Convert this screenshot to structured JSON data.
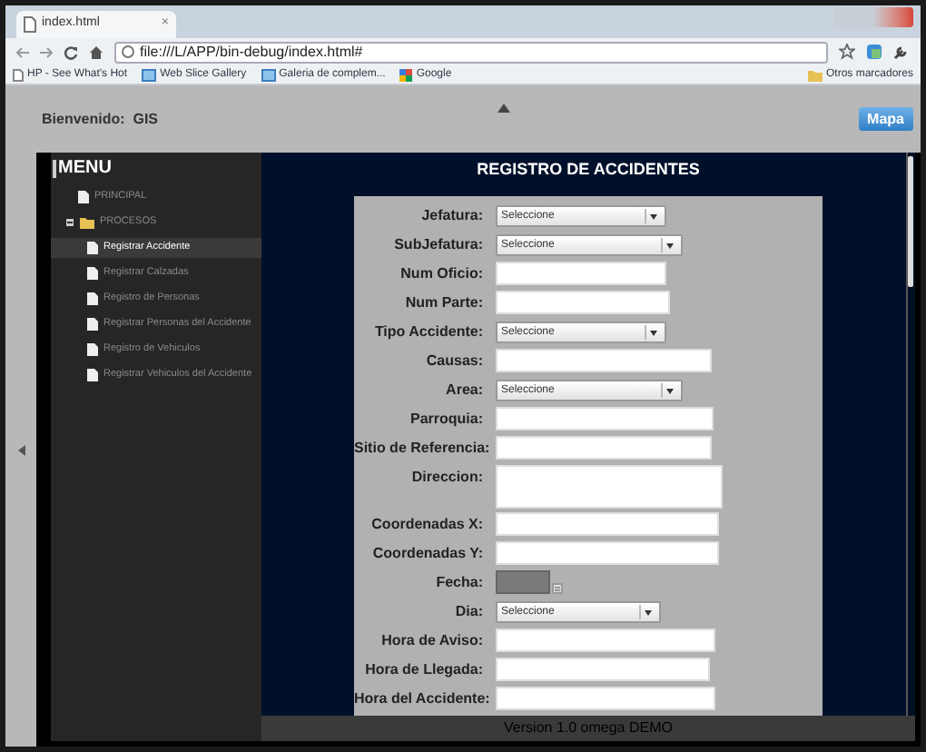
{
  "browser": {
    "tab": {
      "title": "index.html",
      "close": "×"
    },
    "address": "file:///L/APP/bin-debug/index.html#",
    "bookmarks": [
      {
        "label": "HP - See What's Hot",
        "kind": "page"
      },
      {
        "label": "Web Slice Gallery",
        "kind": "slice"
      },
      {
        "label": "Galeria de complem...",
        "kind": "slice"
      },
      {
        "label": "Google",
        "kind": "google"
      }
    ],
    "other_bookmarks": "Otros marcadores"
  },
  "header": {
    "welcome": "Bienvenido:  GIS",
    "map_button": "Mapa"
  },
  "menu": {
    "title": "MENU",
    "items": [
      {
        "label": "PRINCIPAL",
        "kind": "file",
        "selected": false
      },
      {
        "label": "PROCESOS",
        "kind": "folder",
        "expanded": true,
        "selected": false,
        "children": [
          {
            "label": "Registrar Accidente",
            "kind": "file",
            "selected": true
          },
          {
            "label": "Registrar Calzadas",
            "kind": "file",
            "selected": false
          },
          {
            "label": "Registro de Personas",
            "kind": "file",
            "selected": false
          },
          {
            "label": "Registrar Personas del Accidente",
            "kind": "file",
            "selected": false
          },
          {
            "label": "Registro de Vehiculos",
            "kind": "file",
            "selected": false
          },
          {
            "label": "Registrar Vehiculos del Accidente",
            "kind": "file",
            "selected": false
          }
        ]
      }
    ]
  },
  "form": {
    "title": "REGISTRO DE ACCIDENTES",
    "fields": [
      {
        "label": "Jefatura:",
        "kind": "select",
        "value": "Seleccione"
      },
      {
        "label": "SubJefatura:",
        "kind": "select",
        "value": "Seleccione"
      },
      {
        "label": "Num Oficio:",
        "kind": "input"
      },
      {
        "label": "Num Parte:",
        "kind": "input"
      },
      {
        "label": "Tipo Accidente:",
        "kind": "select",
        "value": "Seleccione"
      },
      {
        "label": "Causas:",
        "kind": "input"
      },
      {
        "label": "Area:",
        "kind": "select",
        "value": "Seleccione"
      },
      {
        "label": "Parroquia:",
        "kind": "input"
      },
      {
        "label": "Sitio de Referencia:",
        "kind": "input"
      },
      {
        "label": "Direccion:",
        "kind": "textarea"
      },
      {
        "label": "Coordenadas X:",
        "kind": "input"
      },
      {
        "label": "Coordenadas Y:",
        "kind": "input"
      },
      {
        "label": "Fecha:",
        "kind": "date"
      },
      {
        "label": "Dia:",
        "kind": "select",
        "value": "Seleccione"
      },
      {
        "label": "Hora de Aviso:",
        "kind": "input"
      },
      {
        "label": "Hora de Llegada:",
        "kind": "input"
      },
      {
        "label": "Hora del Accidente:",
        "kind": "input"
      }
    ]
  },
  "footer": "Version 1.0 omega DEMO"
}
